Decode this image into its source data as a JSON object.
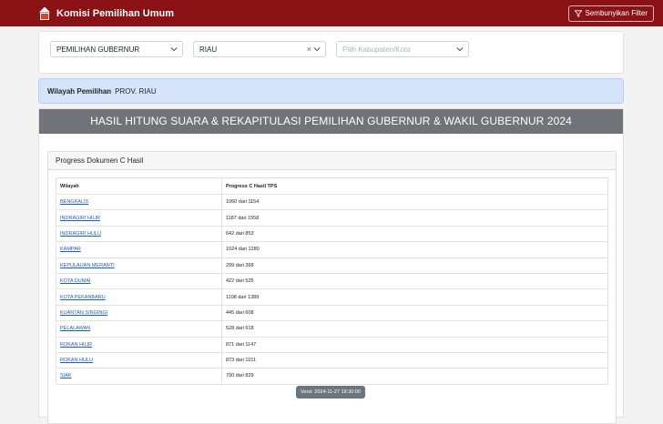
{
  "navbar": {
    "brand": "Komisi Pemilihan Umum",
    "filter_button": "Sembunyikan Filter",
    "colors": {
      "background": "#8b1214"
    }
  },
  "filters": {
    "election": {
      "value": "PEMILIHAN GUBERNUR"
    },
    "province": {
      "value": "RIAU"
    },
    "regency": {
      "placeholder": "Pilih Kabupaten/Kota"
    }
  },
  "region": {
    "label": "Wilayah Pemilihan",
    "value": "PROV. RIAU"
  },
  "main": {
    "title": "HASIL HITUNG SUARA & REKAPITULASI PEMILIHAN GUBERNUR & WAKIL GUBERNUR 2024",
    "section_title": "Progress Dokumen C Hasil",
    "table": {
      "headers": [
        "Wilayah",
        "Progress C Hasil TPS"
      ],
      "rows": [
        {
          "wilayah": "BENGKALIS",
          "progress": "1060 dari 1154"
        },
        {
          "wilayah": "INDRAGIRI HILIR",
          "progress": "1187 dari 1558"
        },
        {
          "wilayah": "INDRAGIRI HULU",
          "progress": "642 dari 853"
        },
        {
          "wilayah": "KAMPAR",
          "progress": "1024 dari 1280"
        },
        {
          "wilayah": "KEPULAUAN MERANTI",
          "progress": "299 dari 368"
        },
        {
          "wilayah": "KOTA DUMAI",
          "progress": "422 dari 525"
        },
        {
          "wilayah": "KOTA PEKANBARU",
          "progress": "1108 dari 1389"
        },
        {
          "wilayah": "KUANTAN SINGINGI",
          "progress": "445 dari 608"
        },
        {
          "wilayah": "PELALAWAN",
          "progress": "528 dari 618"
        },
        {
          "wilayah": "ROKAN HILIR",
          "progress": "871 dari 1147"
        },
        {
          "wilayah": "ROKAN HULU",
          "progress": "873 dari 1151"
        },
        {
          "wilayah": "SIAK",
          "progress": "700 dari 829"
        }
      ]
    },
    "version": "Versi: 2024-11-27 18:30:00"
  }
}
